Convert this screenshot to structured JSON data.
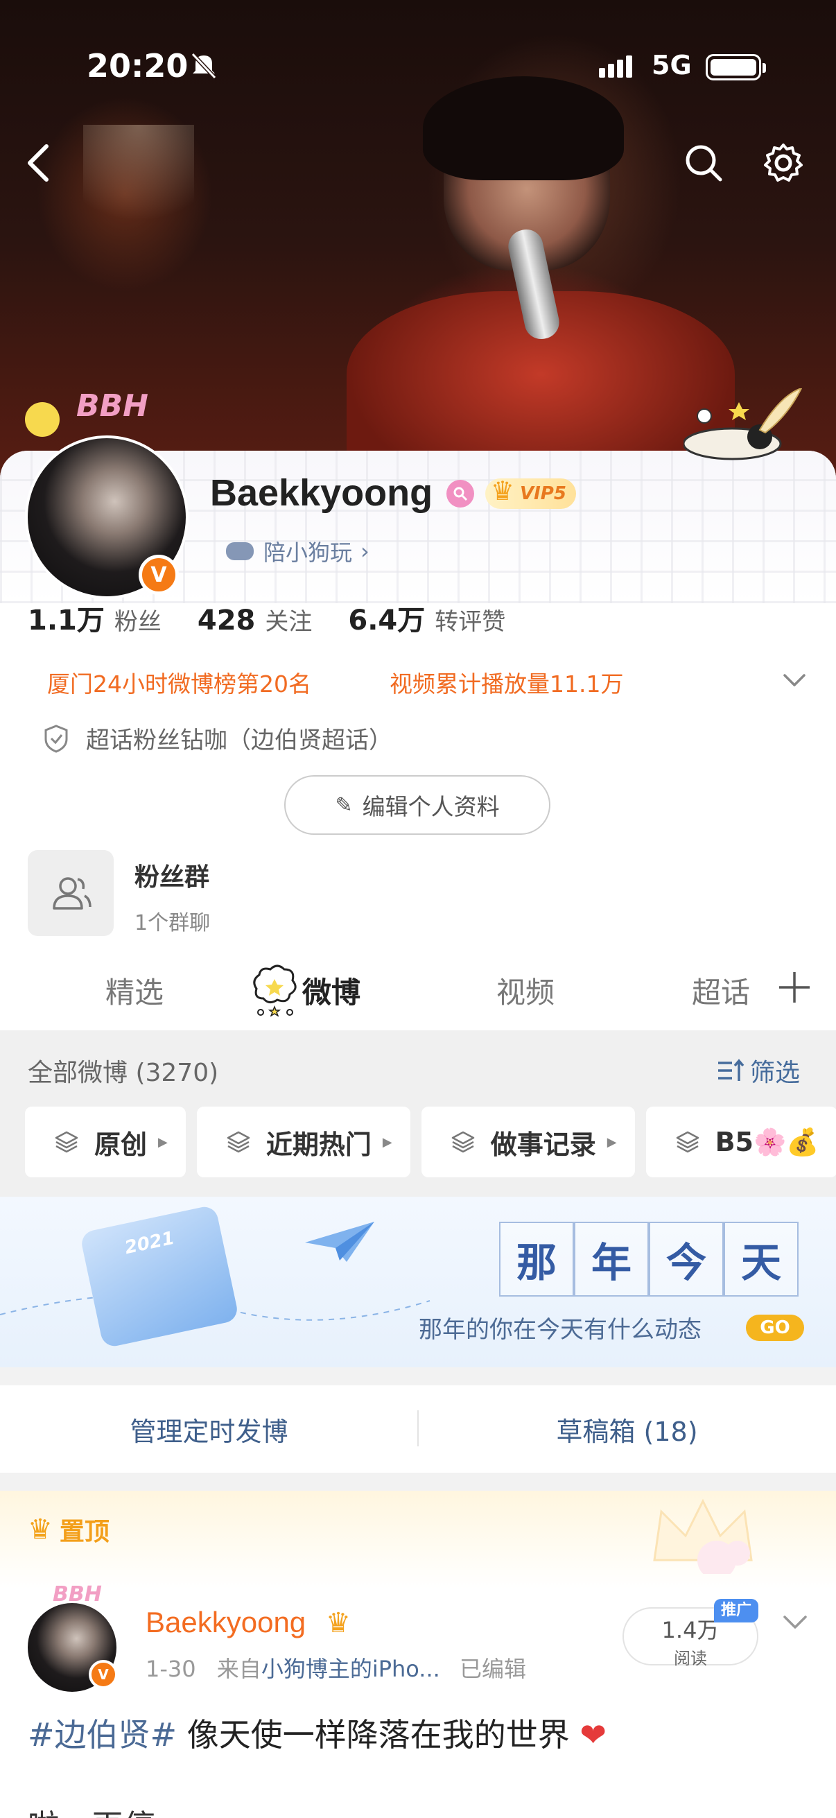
{
  "status_bar": {
    "time": "20:20",
    "network": "5G"
  },
  "profile": {
    "username": "Baekkyoong",
    "vip_label": "VIP5",
    "verified_badge": "V",
    "game_link": "陪小狗玩",
    "game_link_arrow": "›",
    "avatar_deco_text": "BBH",
    "stats": [
      {
        "value": "1.1万",
        "label": "粉丝"
      },
      {
        "value": "428",
        "label": "关注"
      },
      {
        "value": "6.4万",
        "label": "转评赞"
      }
    ],
    "honors": [
      "厦门24小时微博榜第20名",
      "视频累计播放量11.1万"
    ],
    "supertopic": "超话粉丝钻咖（边伯贤超话）",
    "edit_button": "编辑个人资料",
    "fan_group": {
      "title": "粉丝群",
      "subtitle": "1个群聊"
    }
  },
  "tabs": [
    {
      "label": "精选",
      "active": false
    },
    {
      "label": "微博",
      "active": true
    },
    {
      "label": "视频",
      "active": false
    },
    {
      "label": "超话",
      "active": false
    }
  ],
  "feed": {
    "all_label": "全部微博 (3270)",
    "filter_label": "筛选",
    "chips": [
      "原创",
      "近期热门",
      "做事记录",
      "B5🌸💰"
    ],
    "banner": {
      "chars": [
        "那",
        "年",
        "今",
        "天"
      ],
      "subtitle": "那年的你在今天有什么动态",
      "go": "GO",
      "calendar_year": "2021"
    },
    "actions": [
      "管理定时发博",
      "草稿箱 (18)"
    ]
  },
  "pinned_post": {
    "label": "置顶",
    "author": "Baekkyoong",
    "verified_badge": "V",
    "avatar_deco_text": "BBH",
    "date": "1-30",
    "source_prefix": "来自",
    "source": "小狗博主的iPho...",
    "edited": "已编辑",
    "reads_value": "1.4万",
    "reads_label": "阅读",
    "promo_tag": "推广",
    "hashtag": "#边伯贤#",
    "text": " 像天使一样降落在我的世界",
    "heart": "❤",
    "next_line": "啦，再停"
  },
  "colors": {
    "accent_orange": "#f16b22",
    "link_blue": "#4b6a95",
    "verified_orange": "#f57a15",
    "go_yellow": "#f5b51e"
  }
}
